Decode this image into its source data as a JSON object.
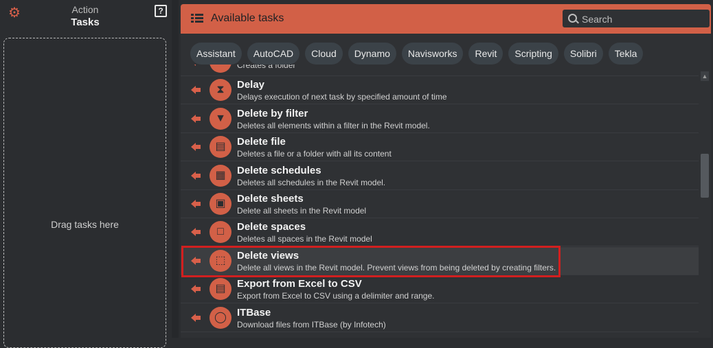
{
  "sidebar": {
    "gear_icon": "gear-icon",
    "action_label": "Action",
    "tasks_label": "Tasks",
    "help_label": "?",
    "drop_text": "Drag tasks here"
  },
  "header": {
    "title": "Available tasks",
    "search_placeholder": "Search"
  },
  "filters": [
    "Assistant",
    "AutoCAD",
    "Cloud",
    "Dynamo",
    "Navisworks",
    "Revit",
    "Scripting",
    "Solibri",
    "Tekla"
  ],
  "tasks": [
    {
      "title": "",
      "desc": "Creates a folder",
      "icon": "folder-icon"
    },
    {
      "title": "Delay",
      "desc": "Delays execution of next task by specified amount of time",
      "icon": "hourglass-icon"
    },
    {
      "title": "Delete by filter",
      "desc": "Deletes all elements within a filter in the Revit model.",
      "icon": "filter-delete-icon"
    },
    {
      "title": "Delete file",
      "desc": "Deletes a file or a folder with all its content",
      "icon": "file-delete-icon"
    },
    {
      "title": "Delete schedules",
      "desc": "Deletes all schedules in the Revit model.",
      "icon": "schedule-delete-icon"
    },
    {
      "title": "Delete sheets",
      "desc": "Delete all sheets in the Revit model",
      "icon": "sheet-delete-icon"
    },
    {
      "title": "Delete spaces",
      "desc": "Deletes all spaces in the Revit model",
      "icon": "space-delete-icon"
    },
    {
      "title": "Delete views",
      "desc": "Delete all views in the Revit model. Prevent views from being deleted by creating filters.",
      "icon": "view-delete-icon",
      "selected": true
    },
    {
      "title": "Export from Excel to CSV",
      "desc": "Export from Excel to CSV using a delimiter and range.",
      "icon": "csv-icon"
    },
    {
      "title": "ITBase",
      "desc": "Download files from ITBase (by Infotech)",
      "icon": "itbase-icon"
    }
  ],
  "colors": {
    "accent": "#d26047",
    "background": "#2b2d30",
    "highlight_border": "#d21f1f"
  }
}
